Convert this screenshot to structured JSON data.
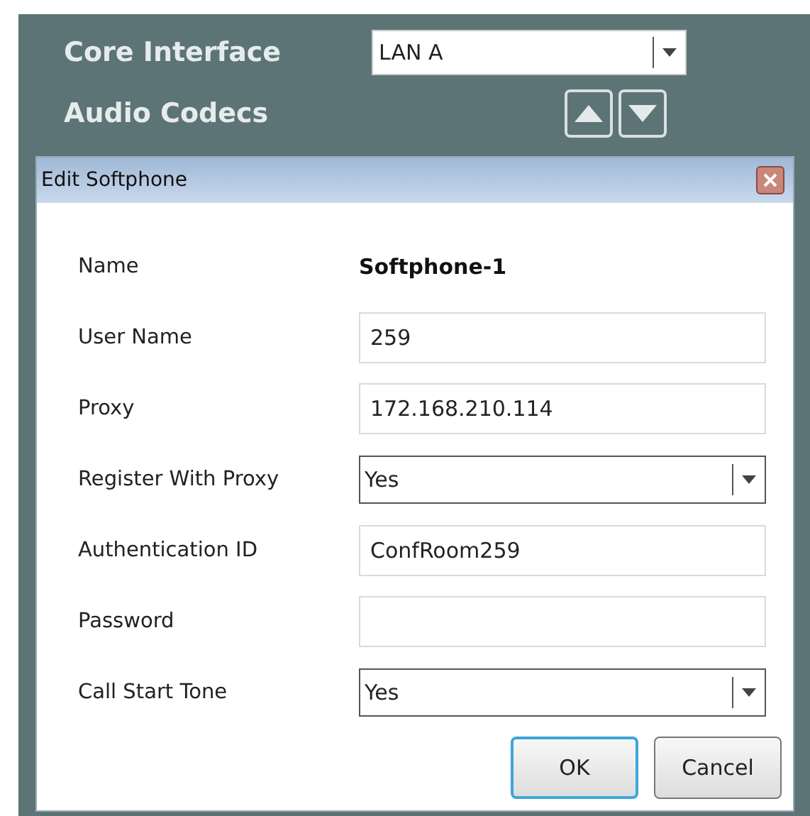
{
  "panel": {
    "fields": [
      {
        "label": "Core Interface",
        "kind": "select",
        "value": "LAN A"
      }
    ],
    "section": {
      "title": "Audio Codecs",
      "buttons": [
        {
          "kind": "up"
        },
        {
          "kind": "down"
        }
      ]
    }
  },
  "dialog": {
    "title": "Edit Softphone",
    "rows": [
      {
        "label": "Name",
        "kind": "static",
        "value": "Softphone-1"
      },
      {
        "label": "User Name",
        "kind": "input",
        "value": "259"
      },
      {
        "label": "Proxy",
        "kind": "input",
        "value": "172.168.210.114"
      },
      {
        "label": "Register With Proxy",
        "kind": "select",
        "value": "Yes"
      },
      {
        "label": "Authentication ID",
        "kind": "input",
        "value": "ConfRoom259"
      },
      {
        "label": "Password",
        "kind": "input"
      },
      {
        "label": "Call Start Tone",
        "kind": "select",
        "value": "Yes"
      }
    ],
    "buttons": [
      {
        "label": "OK",
        "default": true
      },
      {
        "label": "Cancel",
        "default": false
      }
    ]
  }
}
